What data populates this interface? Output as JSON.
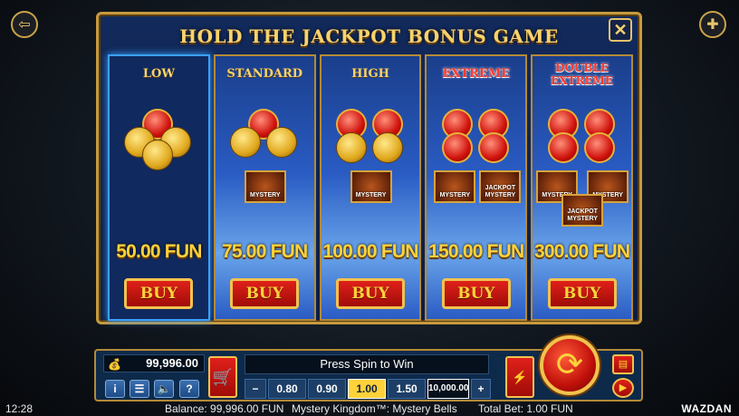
{
  "panel": {
    "title": "HOLD THE JACKPOT BONUS GAME",
    "close_symbol": "✕"
  },
  "options": [
    {
      "label": "LOW",
      "price": "50.00 FUN",
      "buy": "BUY",
      "mystery": []
    },
    {
      "label": "STANDARD",
      "price": "75.00 FUN",
      "buy": "BUY",
      "mystery": [
        "MYSTERY"
      ]
    },
    {
      "label": "HIGH",
      "price": "100.00 FUN",
      "buy": "BUY",
      "mystery": [
        "MYSTERY"
      ]
    },
    {
      "label": "EXTREME",
      "price": "150.00 FUN",
      "buy": "BUY",
      "mystery": [
        "MYSTERY",
        "JACKPOT MYSTERY"
      ]
    },
    {
      "label": "DOUBLE EXTREME",
      "price": "300.00 FUN",
      "buy": "BUY",
      "mystery": [
        "MYSTERY",
        "MYSTERY",
        "JACKPOT MYSTERY"
      ]
    }
  ],
  "bar": {
    "balance": "99,996.00",
    "message": "Press Spin to Win",
    "bets": [
      "0.80",
      "0.90",
      "1.00",
      "1.50",
      "10,000.00"
    ],
    "selected_bet": "1.00",
    "minus": "−",
    "plus": "+",
    "info": "i",
    "menu": "☰",
    "sound": "🔈",
    "help": "?"
  },
  "status": {
    "time": "12:28",
    "balance": "Balance: 99,996.00 FUN",
    "game": "Mystery Kingdom™: Mystery Bells",
    "total_bet": "Total Bet: 1.00 FUN",
    "brand": "WAZDAN"
  },
  "colors": {
    "gold": "#f6d36d",
    "panel": "#122a5c",
    "red": "#d0120c"
  }
}
